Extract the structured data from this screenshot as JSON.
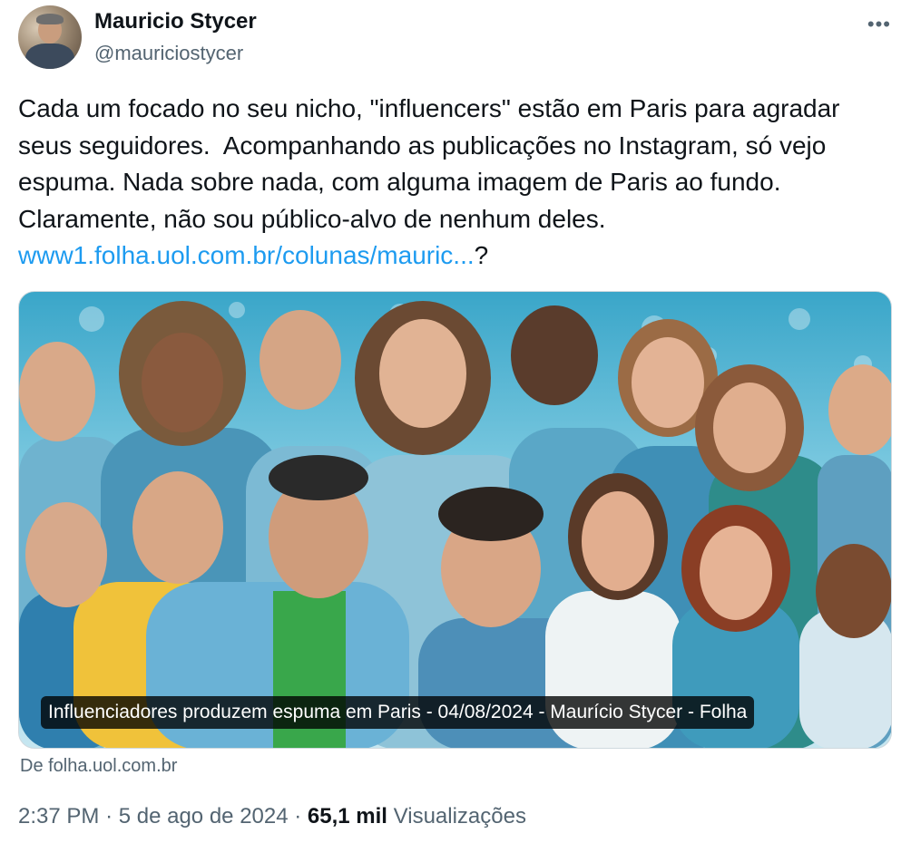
{
  "author": {
    "name": "Mauricio Stycer",
    "handle": "@mauriciostycer"
  },
  "tweet": {
    "text": "Cada um focado no seu nicho, \"influencers\" estão em Paris para agradar seus seguidores.  Acompanhando as publicações no Instagram, só vejo espuma. Nada sobre nada, com alguma imagem de Paris ao fundo. Claramente, não sou público-alvo de nenhum deles.\n",
    "link_text": "www1.folha.uol.com.br/colunas/mauric...",
    "link_suffix": "?"
  },
  "card": {
    "caption": "Influenciadores produzem espuma em Paris - 04/08/2024 - Maurício Stycer - Folha",
    "source": "De folha.uol.com.br"
  },
  "meta": {
    "time": "2:37 PM",
    "separator": "·",
    "date": "5 de ago de 2024",
    "views_count": "65,1 mil",
    "views_label": "Visualizações"
  },
  "icons": {
    "more": "more-horizontal-icon"
  }
}
